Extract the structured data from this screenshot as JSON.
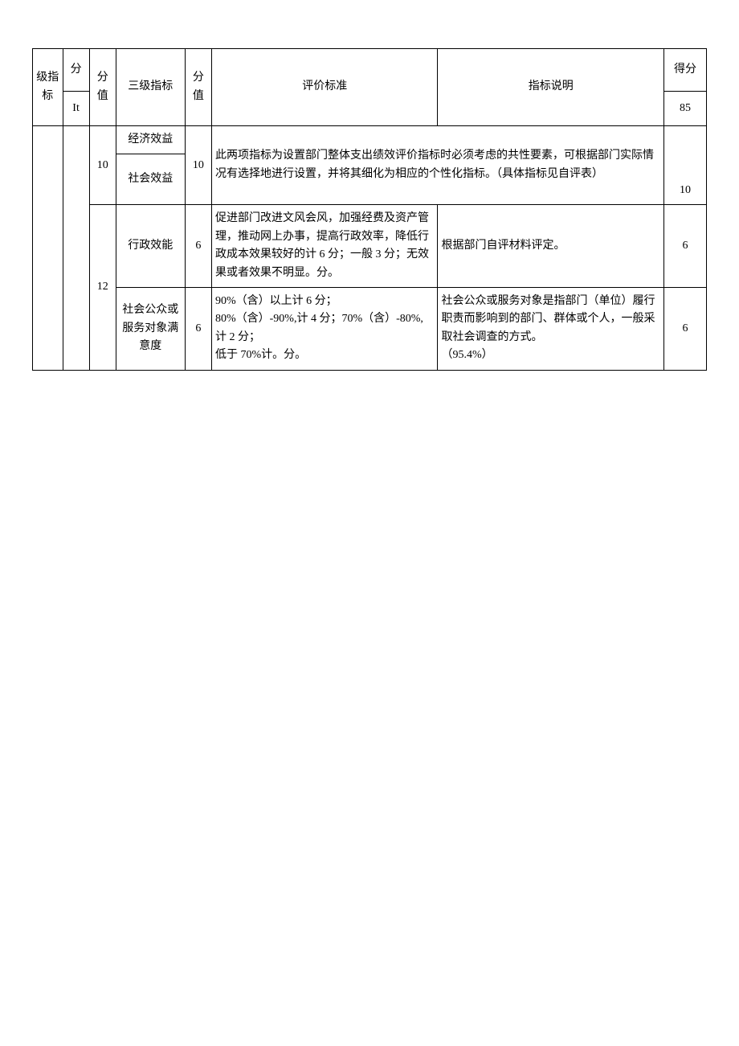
{
  "headers": {
    "h0": "级指标",
    "h1_top": "分",
    "h1_bot": "It",
    "h2": "分值",
    "h3": "三级指标",
    "h4": "分值",
    "h5": "评价标准",
    "h6": "指标说明",
    "h7_top": "得分",
    "h7_bot": "85"
  },
  "rows": {
    "group1_fen": "10",
    "econ": "经济效益",
    "social": "社会效益",
    "g1_val": "10",
    "g1_text": "此两项指标为设置部门整体支出绩效评价指标时必须考虑的共性要素，可根据部门实际情况有选择地进行设置，并将其细化为相应的个性化指标。（具体指标见自评表）",
    "g1_score": "10",
    "group2_fen": "12",
    "admin": "行政效能",
    "admin_val": "6",
    "admin_criteria": "促进部门改进文风会风，加强经费及资产管理，推动网上办事，提高行政效率，降低行政成本效果较好的计 6 分；一般 3 分；无效果或者效果不明显。分。",
    "admin_explain": "根据部门自评材料评定。",
    "admin_score": "6",
    "satis": "社会公众或服务对象满意度",
    "satis_val": "6",
    "satis_criteria": "90%（含）以上计 6 分；\n80%（含）-90%,计 4 分；70%（含）-80%,计 2 分；\n低于 70%计。分。",
    "satis_explain": "社会公众或服务对象是指部门（单位）履行职责而影响到的部门、群体或个人，一般采取社会调查的方式。\n（95.4%）",
    "satis_score": "6"
  }
}
